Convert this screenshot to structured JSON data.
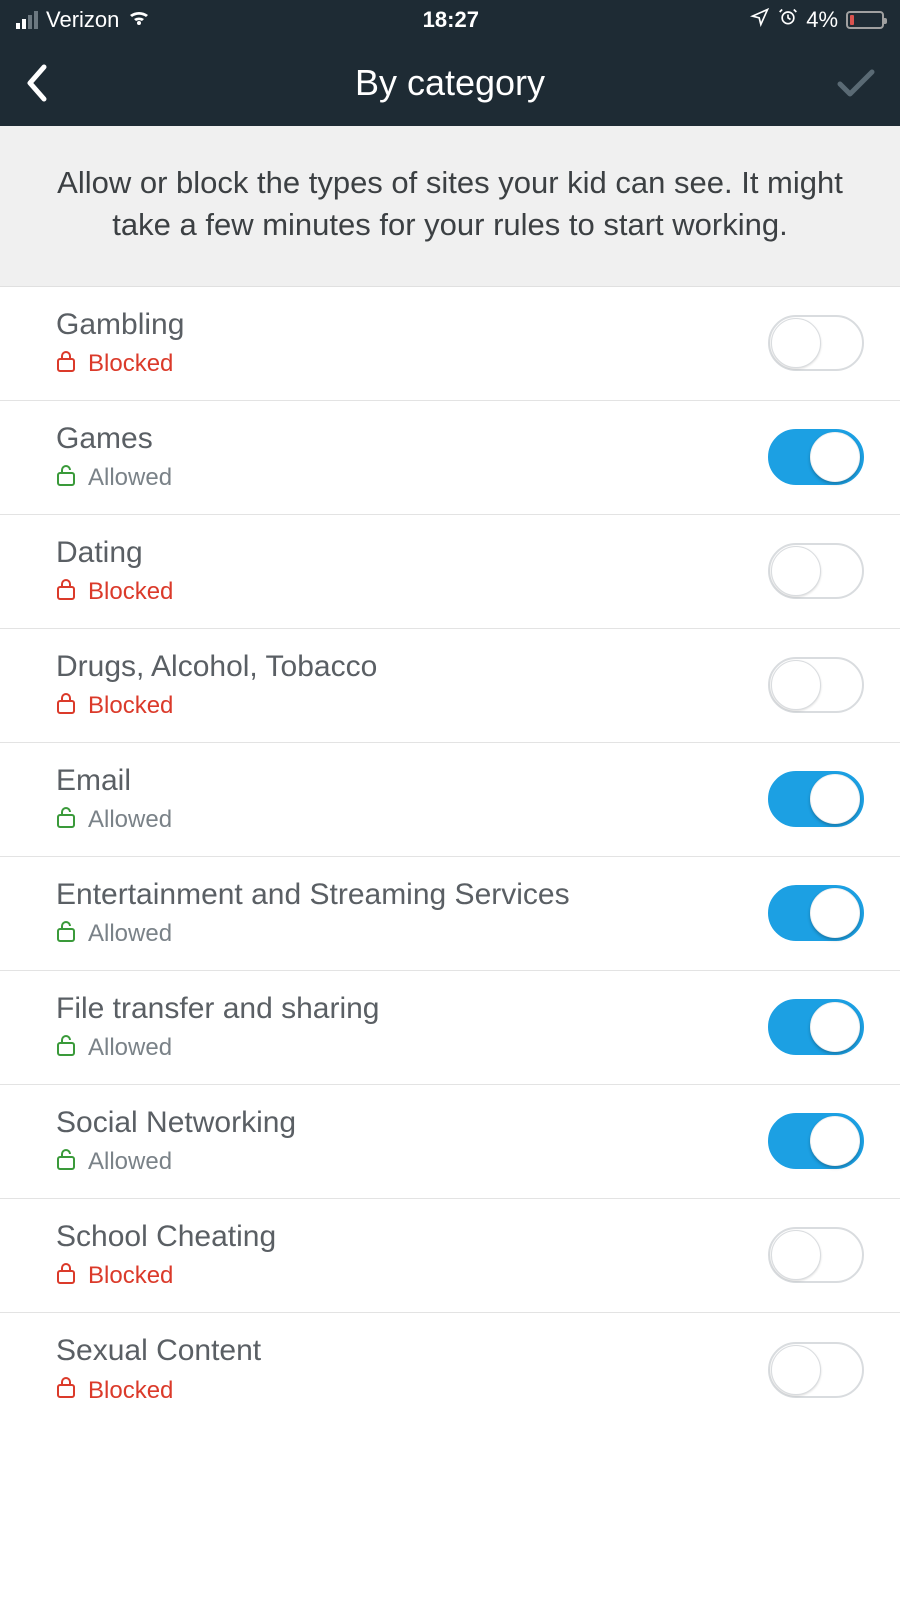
{
  "status": {
    "carrier": "Verizon",
    "time": "18:27",
    "battery_pct": "4%"
  },
  "nav": {
    "title": "By category"
  },
  "description": "Allow or block the types of sites your kid can see. It might take a few minutes for your rules to start working.",
  "labels": {
    "blocked": "Blocked",
    "allowed": "Allowed"
  },
  "categories": [
    {
      "name": "Gambling",
      "allowed": false
    },
    {
      "name": "Games",
      "allowed": true
    },
    {
      "name": "Dating",
      "allowed": false
    },
    {
      "name": "Drugs, Alcohol, Tobacco",
      "allowed": false
    },
    {
      "name": "Email",
      "allowed": true
    },
    {
      "name": "Entertainment and Streaming Services",
      "allowed": true
    },
    {
      "name": "File transfer and sharing",
      "allowed": true
    },
    {
      "name": "Social Networking",
      "allowed": true
    },
    {
      "name": "School Cheating",
      "allowed": false
    },
    {
      "name": "Sexual Content",
      "allowed": false
    }
  ],
  "colors": {
    "accent": "#1ca0e3",
    "blocked": "#db3a2a",
    "allowed": "#3a9a3a",
    "header": "#1e2b34"
  }
}
